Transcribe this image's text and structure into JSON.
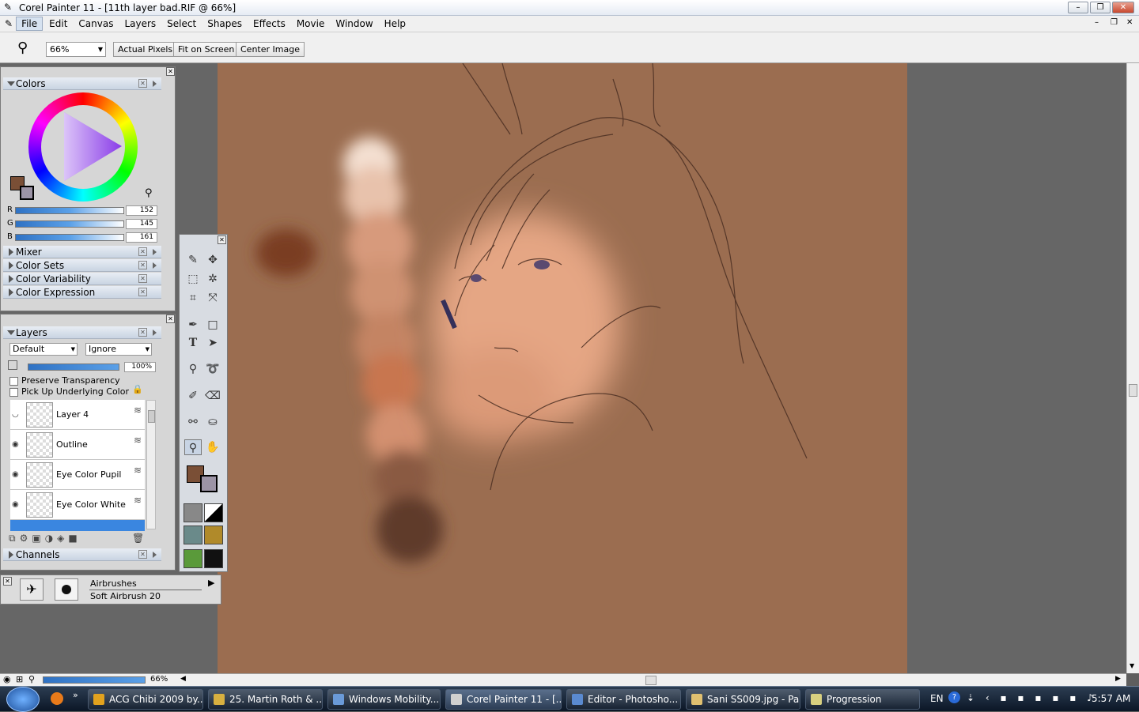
{
  "window": {
    "title": "Corel Painter 11 - [11th layer bad.RIF @ 66%]"
  },
  "menu": {
    "items": [
      "File",
      "Edit",
      "Canvas",
      "Layers",
      "Select",
      "Shapes",
      "Effects",
      "Movie",
      "Window",
      "Help"
    ]
  },
  "toolbar": {
    "zoom_value": "66%",
    "actual_pixels": "Actual Pixels",
    "fit_on_screen": "Fit on Screen",
    "center_image": "Center Image"
  },
  "colors_panel": {
    "title": "Colors",
    "r_label": "R",
    "g_label": "G",
    "b_label": "B",
    "r": "152",
    "g": "145",
    "b": "161",
    "collapsed": [
      "Mixer",
      "Color Sets",
      "Color Variability",
      "Color Expression"
    ]
  },
  "layers_panel": {
    "title": "Layers",
    "composite_method": "Default",
    "depth": "Ignore",
    "opacity": "100%",
    "preserve_transparency": "Preserve Transparency",
    "pick_up": "Pick Up Underlying Color",
    "layers": [
      "Layer 4",
      "Outline",
      "Eye Color Pupil",
      "Eye Color White"
    ]
  },
  "channels_panel": {
    "title": "Channels"
  },
  "brush_selector": {
    "category": "Airbrushes",
    "variant": "Soft Airbrush 20"
  },
  "status": {
    "zoom": "66%"
  },
  "taskbar": {
    "items": [
      "ACG Chibi 2009 by...",
      "25. Martin Roth & ...",
      "Windows Mobility...",
      "Corel Painter 11 - [...",
      "Editor - Photosho...",
      "Sani SS009.jpg - Pa...",
      "Progression"
    ],
    "lang": "EN",
    "time": "5:57 AM"
  },
  "colors": {
    "canvas_bg": "#9b6d50",
    "primary": "#7a4f36",
    "secondary": "#9c94a6"
  }
}
